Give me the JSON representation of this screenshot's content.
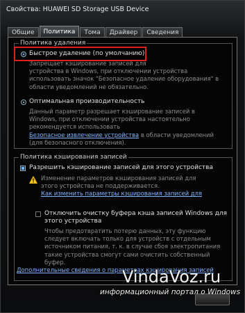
{
  "window": {
    "title": "Свойства: HUAWEI SD Storage USB Device"
  },
  "tabs": [
    {
      "label": "Общие"
    },
    {
      "label": "Политика"
    },
    {
      "label": "Тома"
    },
    {
      "label": "Драйвер"
    },
    {
      "label": "Сведения"
    }
  ],
  "removal_policy": {
    "legend": "Политика удаления",
    "quick": {
      "label": "Быстрое удаление (по умолчанию)",
      "selected": true,
      "desc": [
        "Запрещает кэширование записей для",
        "устройства в Windows, при отключении устройства",
        "использовать значок \"Безопасное удаление оборудования\" в",
        "области уведомлений не обязательно."
      ]
    },
    "performance": {
      "label": "Оптимальная производительность",
      "selected": false,
      "desc": [
        "Данный параметр разрешает кэширование записей в",
        "Windows, при отключении устройства настоятельно",
        "рекомендуется использовать"
      ],
      "link": "Безопасное извлечение устройства",
      "desc_after_link": " в области уведомлений",
      "desc_tail": "(для безопасного отключения)."
    }
  },
  "write_cache": {
    "legend": "Политика кэширования записей",
    "enable": {
      "label": "Разрешить кэширование записей для этого устройства",
      "checked": true,
      "warning": [
        "Изменение параметров кэширования записей для",
        "этого устройства не поддерживается."
      ],
      "link": "Как изменить параметры кэширования записей для"
    },
    "flush": {
      "label_lines": [
        "Отключить очистку буфера кэша записей Windows для",
        "этого устройства"
      ],
      "checked": false,
      "desc": [
        "Чтобы предотвратить потерю данных, эту функцию",
        "следует включать только для устройств с отдельным",
        "источником питания, т. к. в случае сбоя электропитания",
        "такие устройства смогут сами очистить собственный",
        "буфер."
      ]
    },
    "more_link": "Дополнительные сведения о параметрах кэширования записей"
  },
  "watermark": {
    "logo": "VindaVoz.ru",
    "tagline": "информационный портал о Windows"
  },
  "colors": {
    "highlight": "#e0201a",
    "link": "#7fb3ff"
  }
}
